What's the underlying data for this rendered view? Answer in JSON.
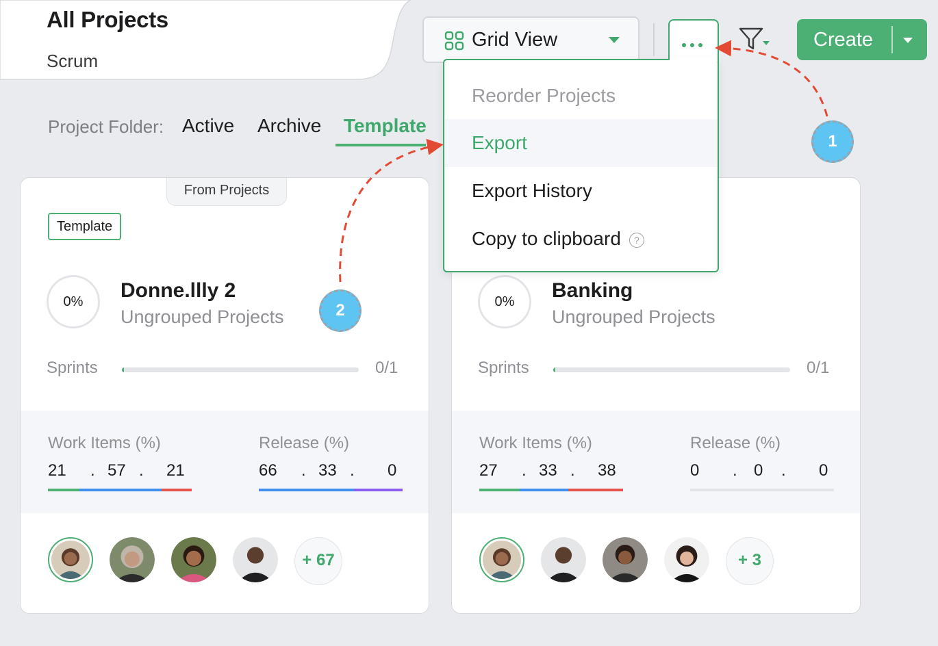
{
  "header": {
    "title": "All Projects",
    "subtitle": "Scrum"
  },
  "toolbar": {
    "view_label": "Grid View",
    "create_label": "Create",
    "more_icon": "more-horizontal-icon",
    "filter_icon": "filter-icon"
  },
  "folder": {
    "label": "Project Folder:",
    "tabs": [
      {
        "label": "Active",
        "selected": false
      },
      {
        "label": "Archive",
        "selected": false
      },
      {
        "label": "Template",
        "selected": true
      }
    ]
  },
  "menu": {
    "items": [
      {
        "label": "Reorder Projects",
        "state": "disabled"
      },
      {
        "label": "Export",
        "state": "hover"
      },
      {
        "label": "Export History",
        "state": "normal"
      },
      {
        "label": "Copy to clipboard",
        "state": "normal",
        "help": "?"
      }
    ]
  },
  "steps": [
    "1",
    "2"
  ],
  "cards": [
    {
      "from_tab": "From Projects",
      "badge": "Template",
      "progress": "0%",
      "name": "Donne.llly 2",
      "group": "Ungrouped Projects",
      "sprints_label": "Sprints",
      "sprints_count": "0/1",
      "sprints_fraction": 0.01,
      "work_items": {
        "label": "Work Items (%)",
        "values": [
          "21",
          "57",
          "21"
        ]
      },
      "release": {
        "label": "Release (%)",
        "values": [
          "66",
          "33",
          "0"
        ]
      },
      "members_more": "+ 67"
    },
    {
      "progress": "0%",
      "name": "Banking",
      "group": "Ungrouped Projects",
      "sprints_label": "Sprints",
      "sprints_count": "0/1",
      "sprints_fraction": 0.01,
      "work_items": {
        "label": "Work Items (%)",
        "values": [
          "27",
          "33",
          "38"
        ]
      },
      "release": {
        "label": "Release (%)",
        "values": [
          "0",
          "0",
          "0"
        ]
      },
      "members_more": "+ 3"
    }
  ],
  "colors": {
    "accent": "#4caf73",
    "done": "#4caf73",
    "in_progress": "#3f8ef0",
    "open": "#e5534b",
    "release_mid": "#3f8ef0",
    "release_end": "#8a5cf0",
    "step": "#5ec4f2",
    "arrow": "#e24a33"
  }
}
